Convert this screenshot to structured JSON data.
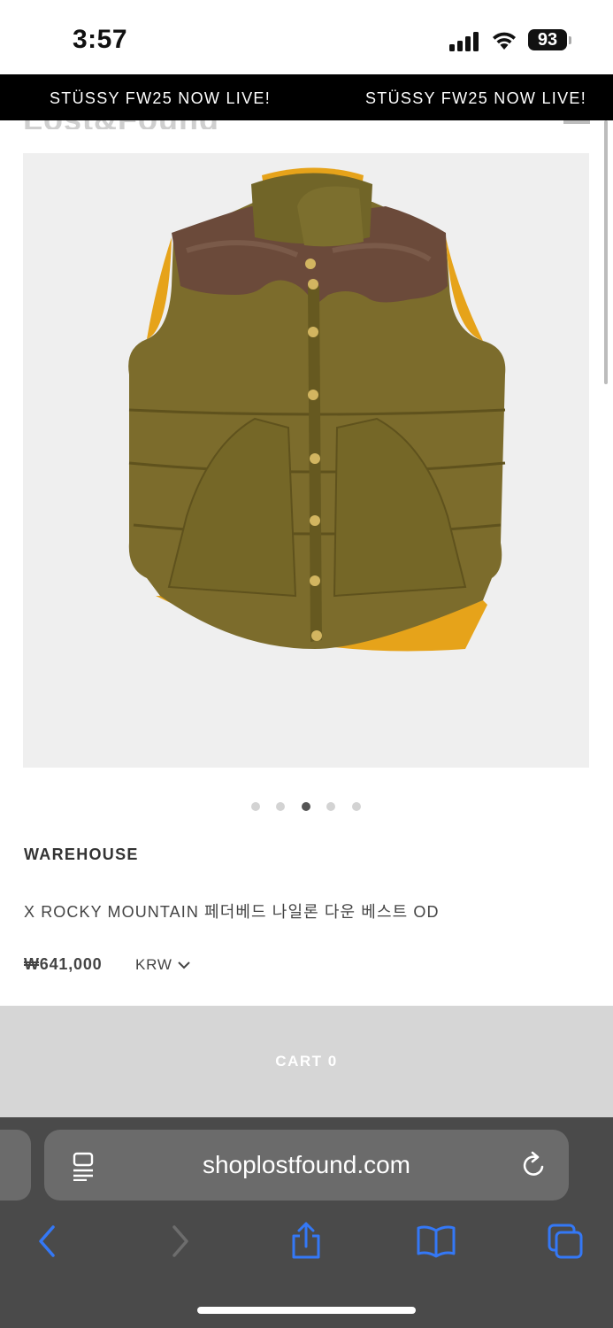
{
  "status_bar": {
    "time": "3:57",
    "battery": "93"
  },
  "announcement": {
    "text_1": "STÜSSY FW25 NOW LIVE!",
    "text_2": "STÜSSY FW25 NOW LIVE!"
  },
  "header": {
    "logo": "Lost&Found"
  },
  "gallery": {
    "slide_count": 5,
    "active_index": 2
  },
  "product": {
    "brand": "WAREHOUSE",
    "name": "X ROCKY MOUNTAIN 페더베드 나일론 다운 베스트 OD",
    "price": "₩641,000",
    "currency": "KRW"
  },
  "cart": {
    "label": "CART 0"
  },
  "browser": {
    "url": "shoplostfound.com",
    "icons": [
      "reader-icon",
      "reload-icon",
      "back-icon",
      "forward-icon",
      "share-icon",
      "bookmarks-icon",
      "tabs-icon"
    ]
  },
  "colors": {
    "accent": "#3478f6",
    "announcement_bg": "#000000",
    "cart_bg": "#d6d6d6",
    "vest": "#7c6c2c",
    "leather": "#6b4a3a",
    "lining": "#e6a31a"
  }
}
